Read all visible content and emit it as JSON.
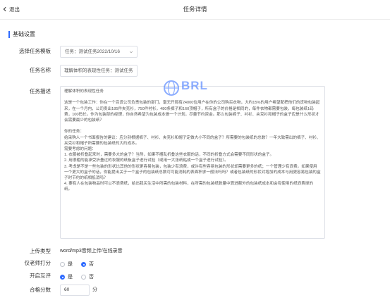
{
  "header": {
    "back_label": "退出",
    "title": "任务详情"
  },
  "section": {
    "title": "基础设置"
  },
  "form": {
    "template_label": "选择任务模板",
    "template_value": "任务：测试任务2022/10/16",
    "name_label": "任务名称",
    "name_value": "理解体积的表现性任务：测试任务",
    "description_label": "任务描述",
    "description_value": "理解体积的表现性任务\n\n这是一个包装工作：你在一个百货公司负责包装的部门，毫无开局有24000位用户在你的公司购买衣物，大约15%的用户希望配把他们的货物包装起来，在一个月内，公司卖出185件夹克衫，750件衬衫，480条裤子和160顶帽子，所有盒子的价格是相同的，每件衣物都需要包装，每包装纸1码费，100码长。作为包装部的经理，你自然希望为包装成本做一个计划，尽量节约资金。那么包装裤子、衬衫、夹克衫和帽子的盒子应是什么形状才会需要最少的包装纸？\n\n你的任务：\n给采购人一个书面报告的建议：应分别根据裤子、衬衫、夹克衫和帽子定做大小不同的盒子？所需要的包装纸的总数？一年大致需出的裤子、衬衫、夹克衫和帽子所需要的包装纸的大约成本。\n需要考虑的问题：\n1. 衣服被折叠起来时，需要多大的盒子？当然，如果不捆乱折叠这些衣服的话，不同的折叠方式会需要不同形状的盒子。\n2. 用很粗的能承受折叠过的衣服的纸板盒子进行试验（或用一大张纸粘成一个盒子进行试验）。\n3. 考虑是不是一些包装的形状比其他的形状更容易包装，包装少有浪费，或许有些容易包装的形状却需要更多的纸；一个管理少有浪费。如果使用一个更大的盒子的话，你能提出关于一个盒子的包装纸总数可可能消耗的表面积求一般法吗吗？或者包装纸的形状对增加的成本与用更容易包装的盒子时节约的纸相抵消吗？\n4. 要有人在包装物品时可以不浪费纸，给出我买生活中所需的包装材料，在所需的包装纸数量中算进额外的包装纸成本和会有使用的纸浪费掉的纸。",
    "upload_label": "上传类型",
    "upload_value": "word/mp3音频上传/在线录音",
    "teacher_only_label": "仅老师打分",
    "teacher_only_options": [
      "是",
      "否"
    ],
    "teacher_only_selected": "否",
    "peer_label": "开启互评",
    "peer_options": [
      "是",
      "否"
    ],
    "peer_selected": "是",
    "pass_score_label": "合格分数",
    "pass_score_value": "60",
    "pass_score_unit": "分"
  },
  "watermark": {
    "text": "BRL"
  },
  "colors": {
    "accent": "#2f6bff",
    "border": "#dcdfe6"
  }
}
